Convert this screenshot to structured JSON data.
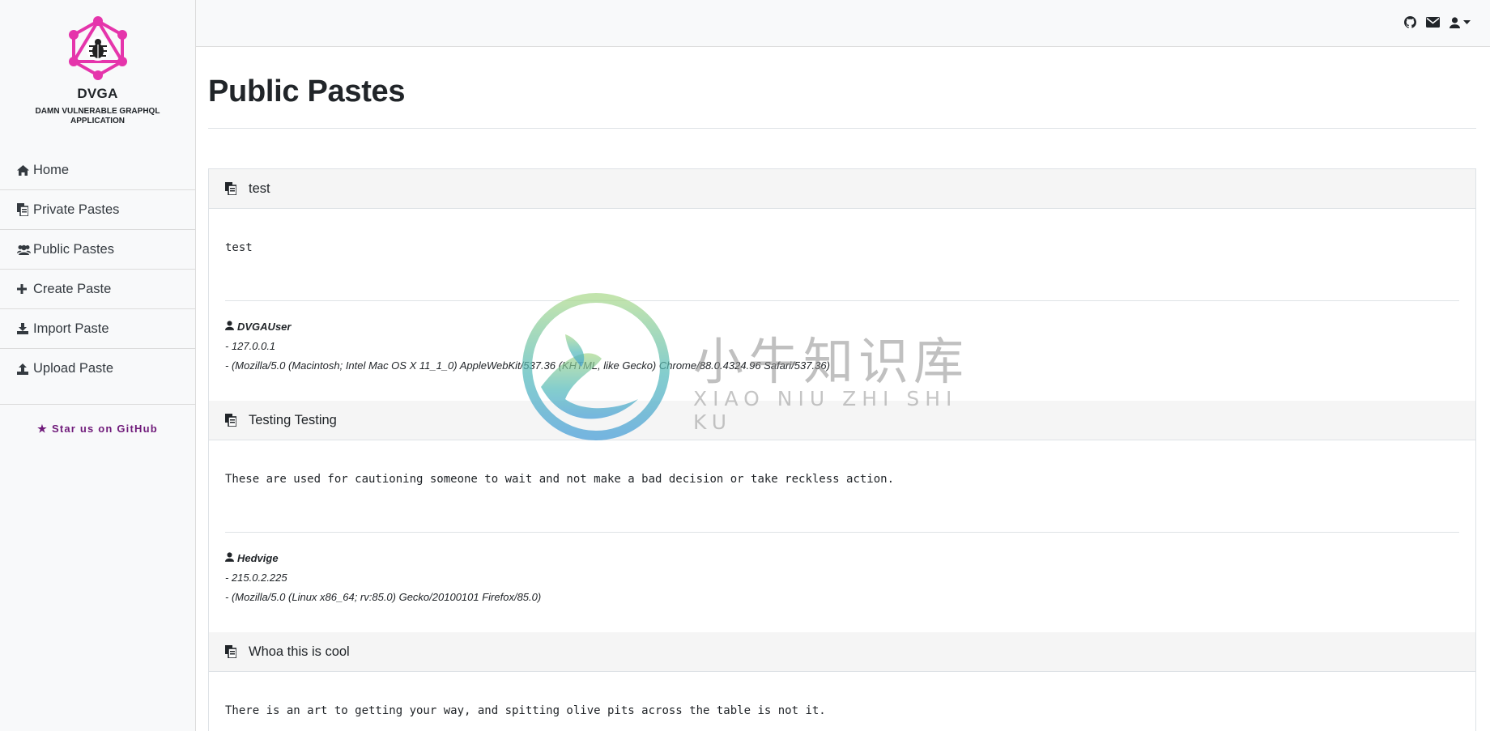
{
  "brand": {
    "name": "DVGA",
    "subtitle": "DAMN VULNERABLE GRAPHQL APPLICATION",
    "colors": {
      "logo": "#e535ab"
    }
  },
  "sidebar": {
    "items": [
      {
        "label": "Home",
        "icon": "home-icon"
      },
      {
        "label": "Private Pastes",
        "icon": "copy-icon"
      },
      {
        "label": "Public Pastes",
        "icon": "users-icon"
      },
      {
        "label": "Create Paste",
        "icon": "plus-icon"
      },
      {
        "label": "Import Paste",
        "icon": "download-icon"
      },
      {
        "label": "Upload Paste",
        "icon": "upload-icon"
      }
    ],
    "star_label": "Star us on GitHub",
    "star_color": "#6f1a7a"
  },
  "topbar": {
    "icons": [
      "github-icon",
      "envelope-icon",
      "user-icon",
      "caret-down-icon"
    ]
  },
  "main": {
    "title": "Public Pastes"
  },
  "pastes": [
    {
      "title": "test",
      "content": "test",
      "author": "DVGAUser",
      "ip": "- 127.0.0.1",
      "user_agent": "- (Mozilla/5.0 (Macintosh; Intel Mac OS X 11_1_0) AppleWebKit/537.36 (KHTML, like Gecko) Chrome/88.0.4324.96 Safari/537.36)"
    },
    {
      "title": "Testing Testing",
      "content": "These are used for cautioning someone to wait and not make a bad decision or take reckless action.",
      "author": "Hedvige",
      "ip": "- 215.0.2.225",
      "user_agent": "- (Mozilla/5.0 (Linux x86_64; rv:85.0) Gecko/20100101 Firefox/85.0)"
    },
    {
      "title": "Whoa this is cool",
      "content": "There is an art to getting your way, and spitting olive pits across the table is not it."
    }
  ],
  "watermark": {
    "chinese": "小牛知识库",
    "pinyin": "XIAO NIU ZHI SHI KU"
  }
}
